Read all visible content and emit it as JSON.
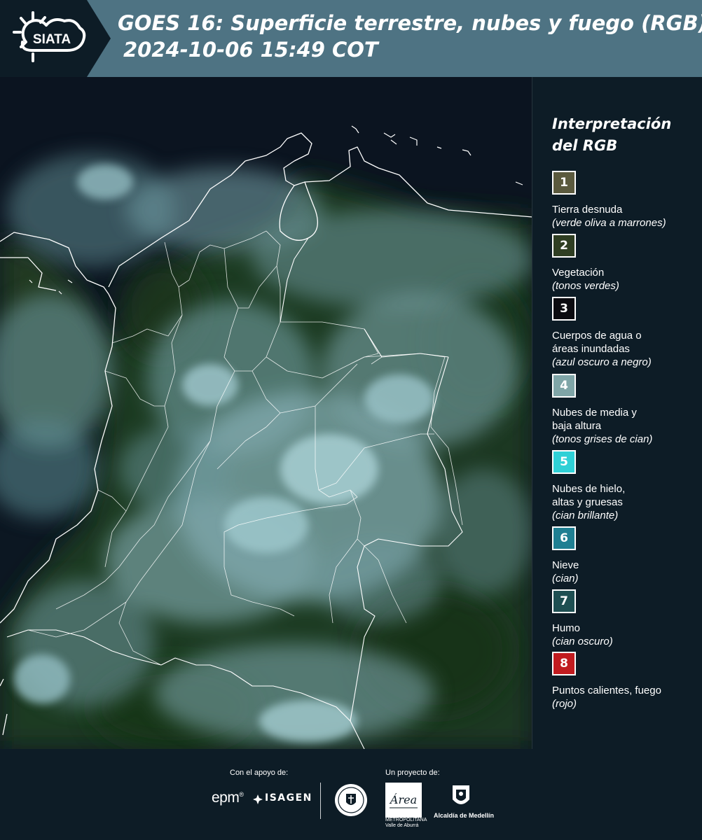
{
  "header": {
    "logo_text": "SIATA",
    "title_line1": "GOES 16: Superficie terrestre, nubes y fuego (RGB)",
    "title_line2": "2024-10-06 15:49 COT"
  },
  "colors": {
    "header_bg": "#4e7383",
    "logo_bg": "#0d1c26",
    "page_bg": "#0d1c26",
    "border_lines": "#ffffff"
  },
  "legend": {
    "title_line1": "Interpretación",
    "title_line2": "del RGB",
    "items": [
      {
        "number": "1",
        "name": "Tierra desnuda",
        "desc": "(verde oliva a marrones)",
        "color": "#5b5a3e"
      },
      {
        "number": "2",
        "name": "Vegetación",
        "desc": "(tonos verdes)",
        "color": "#2f3e22"
      },
      {
        "number": "3",
        "name": "Cuerpos de agua o áreas inundadas",
        "desc": "(azul oscuro a negro)",
        "color": "#0b0b10"
      },
      {
        "number": "4",
        "name": "Nubes de media y baja altura",
        "desc": "(tonos grises de cian)",
        "color": "#7fa5a7"
      },
      {
        "number": "5",
        "name": "Nubes de hielo, altas y gruesas",
        "desc": "(cian brillante)",
        "color": "#2fd0d6"
      },
      {
        "number": "6",
        "name": "Nieve",
        "desc": "(cian)",
        "color": "#1f7f92"
      },
      {
        "number": "7",
        "name": "Humo",
        "desc": "(cian oscuro)",
        "color": "#1e4f52"
      },
      {
        "number": "8",
        "name": "Puntos calientes, fuego",
        "desc": "(rojo)",
        "color": "#c11b1f"
      }
    ]
  },
  "footer": {
    "support_label": "Con el apoyo de:",
    "project_label": "Un proyecto de:",
    "sponsor1": "epm",
    "sponsor1_mark": "®",
    "sponsor2": "ISAGEN",
    "area_text": "METROPOLITANA Valle de Aburrá",
    "area_script": "Área",
    "medellin_label": "Alcaldía de Medellín"
  }
}
